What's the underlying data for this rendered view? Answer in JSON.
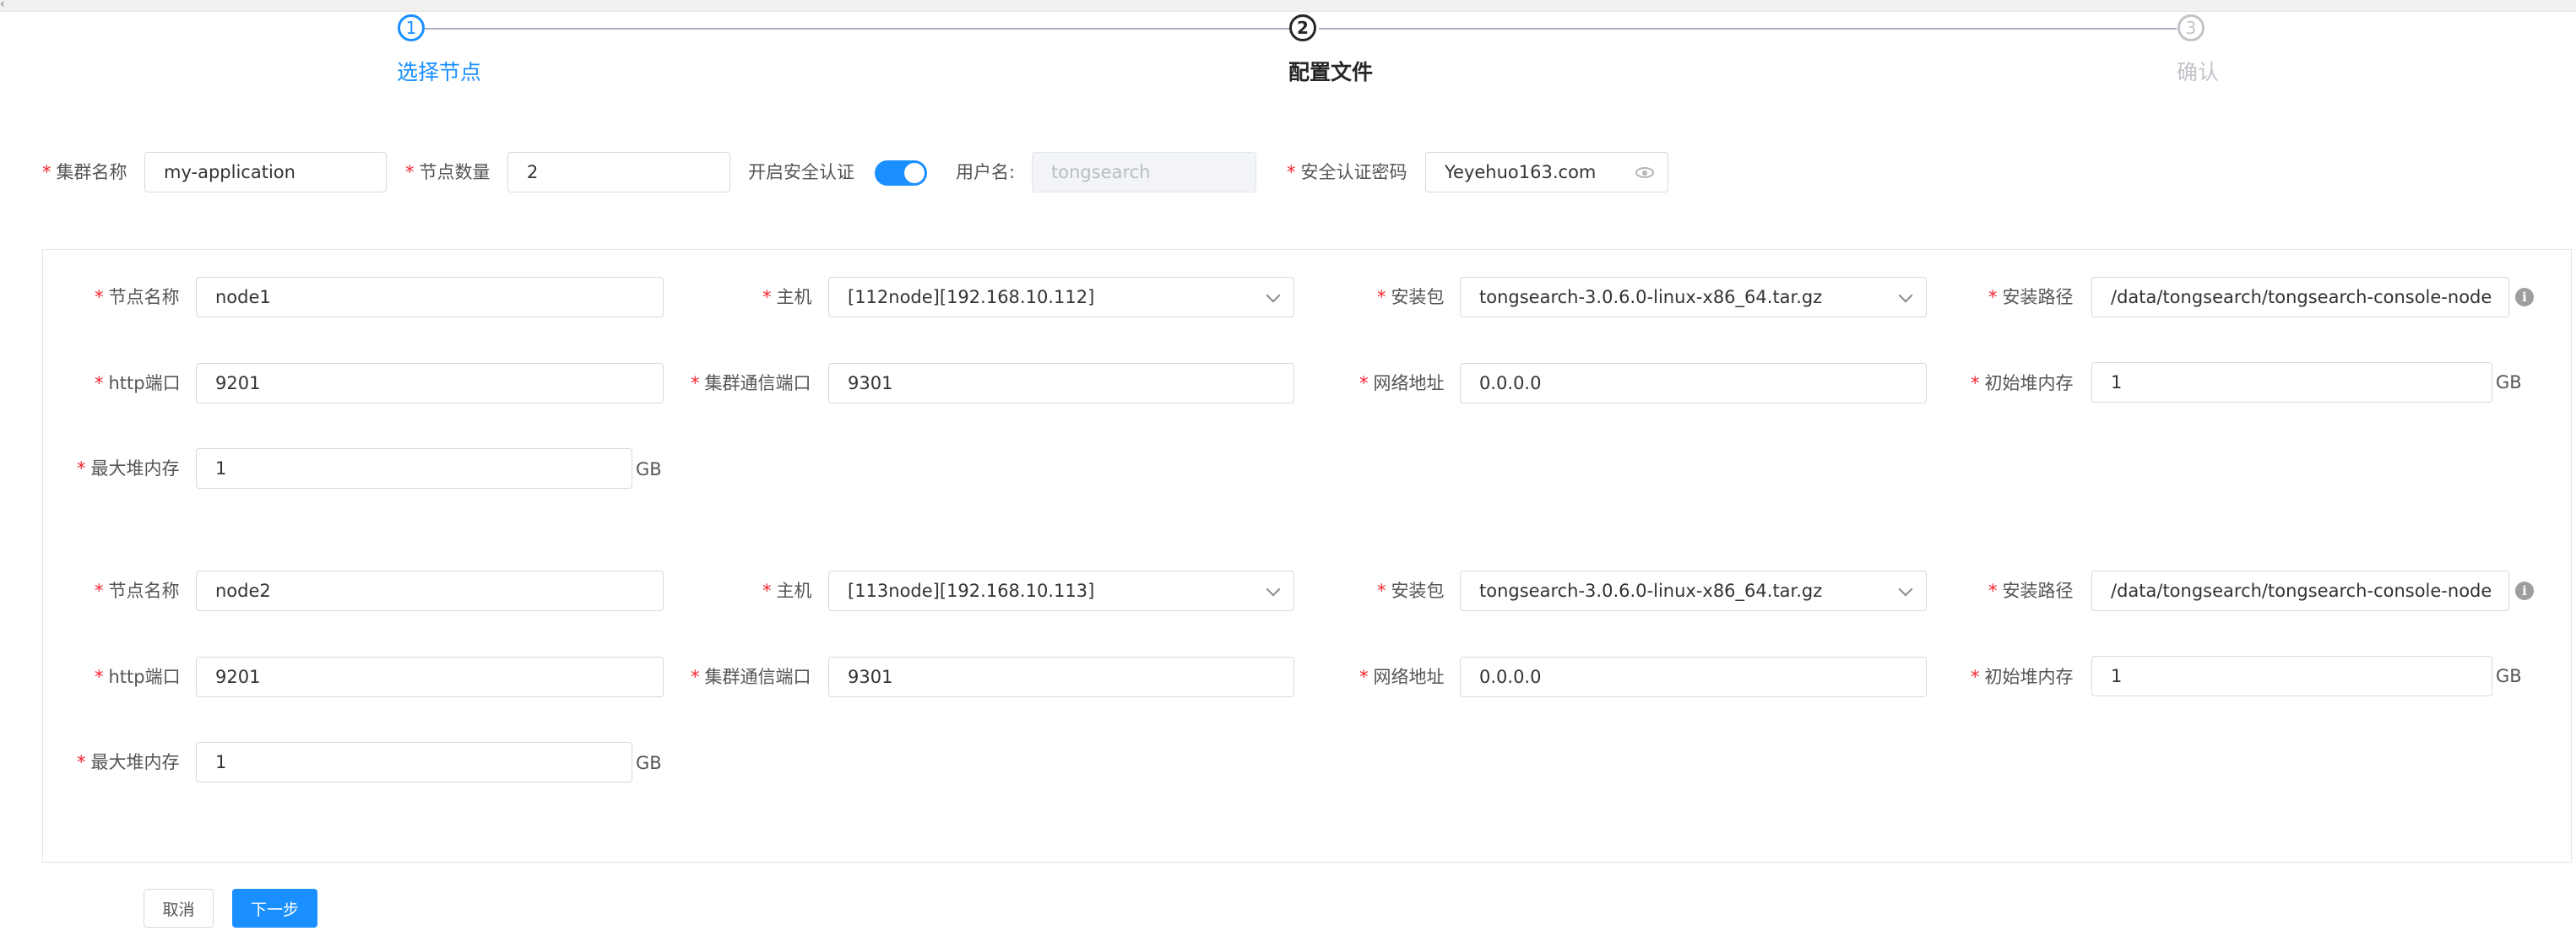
{
  "steps": [
    {
      "number": "1",
      "title": "选择节点"
    },
    {
      "number": "2",
      "title": "配置文件"
    },
    {
      "number": "3",
      "title": "确认"
    }
  ],
  "cluster": {
    "name_label": "集群名称",
    "name_value": "my-application",
    "count_label": "节点数量",
    "count_value": "2",
    "security_label": "开启安全认证",
    "security_enabled": true,
    "username_label": "用户名:",
    "username_placeholder": "tongsearch",
    "password_label": "安全认证密码",
    "password_value": "Yeyehuo163.com"
  },
  "labels": {
    "node_name": "节点名称",
    "host": "主机",
    "package": "安装包",
    "path": "安装路径",
    "http_port": "http端口",
    "transport_port": "集群通信端口",
    "network": "网络地址",
    "init_heap": "初始堆内存",
    "max_heap": "最大堆内存",
    "unit": "GB"
  },
  "nodes": [
    {
      "name": "node1",
      "host": "[112node][192.168.10.112]",
      "package": "tongsearch-3.0.6.0-linux-x86_64.tar.gz",
      "path": "/data/tongsearch/tongsearch-console-node",
      "http_port": "9201",
      "transport_port": "9301",
      "network": "0.0.0.0",
      "init_heap": "1",
      "max_heap": "1"
    },
    {
      "name": "node2",
      "host": "[113node][192.168.10.113]",
      "package": "tongsearch-3.0.6.0-linux-x86_64.tar.gz",
      "path": "/data/tongsearch/tongsearch-console-node",
      "http_port": "9201",
      "transport_port": "9301",
      "network": "0.0.0.0",
      "init_heap": "1",
      "max_heap": "1"
    }
  ],
  "actions": {
    "cancel": "取消",
    "next": "下一步"
  }
}
